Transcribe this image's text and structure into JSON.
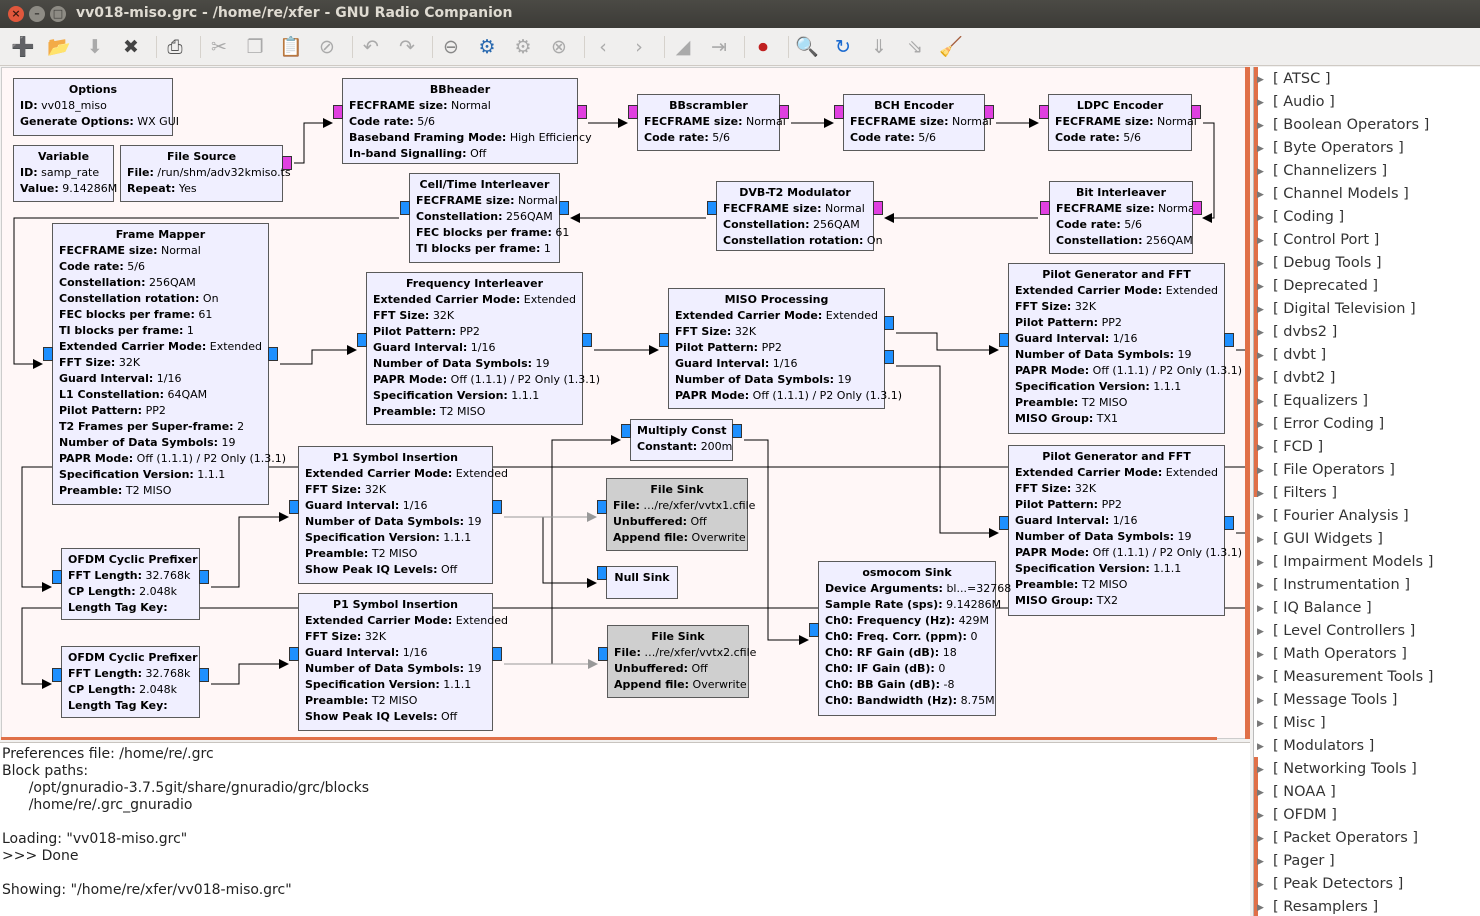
{
  "window": {
    "title": "vv018-miso.grc - /home/re/xfer - GNU Radio Companion",
    "close": "×",
    "minimize": "–",
    "maximize": "□"
  },
  "toolbar": [
    {
      "name": "new-icon",
      "glyph": "➕",
      "color": "#3c9a3c"
    },
    {
      "name": "open-icon",
      "glyph": "📂",
      "color": "#c87020"
    },
    {
      "name": "save-icon",
      "glyph": "⬇",
      "color": "#aaa"
    },
    {
      "name": "close-flowgraph-icon",
      "glyph": "✖",
      "color": "#444"
    },
    {
      "sep": true
    },
    {
      "name": "print-icon",
      "glyph": "⎙",
      "color": "#555"
    },
    {
      "sep": true
    },
    {
      "name": "cut-icon",
      "glyph": "✂",
      "color": "#aaa"
    },
    {
      "name": "copy-icon",
      "glyph": "❐",
      "color": "#aaa"
    },
    {
      "name": "paste-icon",
      "glyph": "📋",
      "color": "#aaa"
    },
    {
      "name": "delete-icon",
      "glyph": "⊘",
      "color": "#aaa"
    },
    {
      "sep": true
    },
    {
      "name": "undo-icon",
      "glyph": "↶",
      "color": "#aaa"
    },
    {
      "name": "redo-icon",
      "glyph": "↷",
      "color": "#aaa"
    },
    {
      "sep": true
    },
    {
      "name": "disable-icon",
      "glyph": "⊖",
      "color": "#888"
    },
    {
      "name": "generate-icon",
      "glyph": "⚙",
      "color": "#2a6ab0"
    },
    {
      "name": "execute-icon",
      "glyph": "⚙",
      "color": "#aaa"
    },
    {
      "name": "kill-icon",
      "glyph": "⊗",
      "color": "#aaa"
    },
    {
      "sep": true
    },
    {
      "name": "rotate-ccw-icon",
      "glyph": "‹",
      "color": "#aaa"
    },
    {
      "name": "rotate-cw-icon",
      "glyph": "›",
      "color": "#aaa"
    },
    {
      "sep": true
    },
    {
      "name": "enable-icon",
      "glyph": "◢",
      "color": "#aaa"
    },
    {
      "name": "bypass-icon",
      "glyph": "⇥",
      "color": "#aaa"
    },
    {
      "sep": true
    },
    {
      "name": "screenshot-icon",
      "glyph": "⏺",
      "color": "#c02020"
    },
    {
      "sep": true
    },
    {
      "name": "find-block-icon",
      "glyph": "🔍",
      "color": "#1a4a8a"
    },
    {
      "name": "reload-icon",
      "glyph": "↻",
      "color": "#1a6ad0"
    },
    {
      "name": "move-down-icon",
      "glyph": "⇓",
      "color": "#aaa"
    },
    {
      "name": "move-up-icon",
      "glyph": "⇘",
      "color": "#aaa"
    },
    {
      "name": "clean-icon",
      "glyph": "🧹",
      "color": "#c8a020"
    }
  ],
  "blocks": [
    {
      "name": "Options",
      "gray": false,
      "rows": [
        [
          "ID:",
          "vv018_miso"
        ],
        [
          "Generate Options:",
          "WX GUI"
        ]
      ]
    },
    {
      "name": "Variable",
      "gray": false,
      "rows": [
        [
          "ID:",
          "samp_rate"
        ],
        [
          "Value:",
          "9.14286M"
        ]
      ]
    },
    {
      "name": "File Source",
      "gray": false,
      "rows": [
        [
          "File:",
          "/run/shm/adv32kmiso.ts"
        ],
        [
          "Repeat:",
          "Yes"
        ]
      ]
    },
    {
      "name": "BBheader",
      "gray": false,
      "rows": [
        [
          "FECFRAME size:",
          "Normal"
        ],
        [
          "Code rate:",
          "5/6"
        ],
        [
          "Baseband Framing Mode:",
          "High Efficiency"
        ],
        [
          "In-band Signalling:",
          "Off"
        ]
      ]
    },
    {
      "name": "BBscrambler",
      "gray": false,
      "rows": [
        [
          "FECFRAME size:",
          "Normal"
        ],
        [
          "Code rate:",
          "5/6"
        ]
      ]
    },
    {
      "name": "BCH Encoder",
      "gray": false,
      "rows": [
        [
          "FECFRAME size:",
          "Normal"
        ],
        [
          "Code rate:",
          "5/6"
        ]
      ]
    },
    {
      "name": "LDPC Encoder",
      "gray": false,
      "rows": [
        [
          "FECFRAME size:",
          "Normal"
        ],
        [
          "Code rate:",
          "5/6"
        ]
      ]
    },
    {
      "name": "Cell/Time Interleaver",
      "gray": false,
      "rows": [
        [
          "FECFRAME size:",
          "Normal"
        ],
        [
          "Constellation:",
          "256QAM"
        ],
        [
          "FEC blocks per frame:",
          "61"
        ],
        [
          "TI blocks per frame:",
          "1"
        ]
      ]
    },
    {
      "name": "DVB-T2 Modulator",
      "gray": false,
      "rows": [
        [
          "FECFRAME size:",
          "Normal"
        ],
        [
          "Constellation:",
          "256QAM"
        ],
        [
          "Constellation rotation:",
          "On"
        ]
      ]
    },
    {
      "name": "Bit Interleaver",
      "gray": false,
      "rows": [
        [
          "FECFRAME size:",
          "Normal"
        ],
        [
          "Code rate:",
          "5/6"
        ],
        [
          "Constellation:",
          "256QAM"
        ]
      ]
    },
    {
      "name": "Frame Mapper",
      "gray": false,
      "rows": [
        [
          "FECFRAME size:",
          "Normal"
        ],
        [
          "Code rate:",
          "5/6"
        ],
        [
          "Constellation:",
          "256QAM"
        ],
        [
          "Constellation rotation:",
          "On"
        ],
        [
          "FEC blocks per frame:",
          "61"
        ],
        [
          "TI blocks per frame:",
          "1"
        ],
        [
          "Extended Carrier Mode:",
          "Extended"
        ],
        [
          "FFT Size:",
          "32K"
        ],
        [
          "Guard Interval:",
          "1/16"
        ],
        [
          "L1 Constellation:",
          "64QAM"
        ],
        [
          "Pilot Pattern:",
          "PP2"
        ],
        [
          "T2 Frames per Super-frame:",
          "2"
        ],
        [
          "Number of Data Symbols:",
          "19"
        ],
        [
          "PAPR Mode:",
          "Off (1.1.1) / P2 Only (1.3.1)"
        ],
        [
          "Specification Version:",
          "1.1.1"
        ],
        [
          "Preamble:",
          "T2 MISO"
        ]
      ]
    },
    {
      "name": "Frequency Interleaver",
      "gray": false,
      "rows": [
        [
          "Extended Carrier Mode:",
          "Extended"
        ],
        [
          "FFT Size:",
          "32K"
        ],
        [
          "Pilot Pattern:",
          "PP2"
        ],
        [
          "Guard Interval:",
          "1/16"
        ],
        [
          "Number of Data Symbols:",
          "19"
        ],
        [
          "PAPR Mode:",
          "Off (1.1.1) / P2 Only (1.3.1)"
        ],
        [
          "Specification Version:",
          "1.1.1"
        ],
        [
          "Preamble:",
          "T2 MISO"
        ]
      ]
    },
    {
      "name": "MISO Processing",
      "gray": false,
      "rows": [
        [
          "Extended Carrier Mode:",
          "Extended"
        ],
        [
          "FFT Size:",
          "32K"
        ],
        [
          "Pilot Pattern:",
          "PP2"
        ],
        [
          "Guard Interval:",
          "1/16"
        ],
        [
          "Number of Data Symbols:",
          "19"
        ],
        [
          "PAPR Mode:",
          "Off (1.1.1) / P2 Only (1.3.1)"
        ]
      ]
    },
    {
      "name": "Pilot Generator and FFT",
      "gray": false,
      "rows": [
        [
          "Extended Carrier Mode:",
          "Extended"
        ],
        [
          "FFT Size:",
          "32K"
        ],
        [
          "Pilot Pattern:",
          "PP2"
        ],
        [
          "Guard Interval:",
          "1/16"
        ],
        [
          "Number of Data Symbols:",
          "19"
        ],
        [
          "PAPR Mode:",
          "Off (1.1.1) / P2 Only (1.3.1)"
        ],
        [
          "Specification Version:",
          "1.1.1"
        ],
        [
          "Preamble:",
          "T2 MISO"
        ],
        [
          "MISO Group:",
          "TX1"
        ]
      ]
    },
    {
      "name": "Pilot Generator and FFT",
      "gray": false,
      "rows": [
        [
          "Extended Carrier Mode:",
          "Extended"
        ],
        [
          "FFT Size:",
          "32K"
        ],
        [
          "Pilot Pattern:",
          "PP2"
        ],
        [
          "Guard Interval:",
          "1/16"
        ],
        [
          "Number of Data Symbols:",
          "19"
        ],
        [
          "PAPR Mode:",
          "Off (1.1.1) / P2 Only (1.3.1)"
        ],
        [
          "Specification Version:",
          "1.1.1"
        ],
        [
          "Preamble:",
          "T2 MISO"
        ],
        [
          "MISO Group:",
          "TX2"
        ]
      ]
    },
    {
      "name": "Multiply Const",
      "gray": false,
      "rows": [
        [
          "Constant:",
          "200m"
        ]
      ]
    },
    {
      "name": "P1 Symbol Insertion",
      "gray": false,
      "rows": [
        [
          "Extended Carrier Mode:",
          "Extended"
        ],
        [
          "FFT Size:",
          "32K"
        ],
        [
          "Guard Interval:",
          "1/16"
        ],
        [
          "Number of Data Symbols:",
          "19"
        ],
        [
          "Specification Version:",
          "1.1.1"
        ],
        [
          "Preamble:",
          "T2 MISO"
        ],
        [
          "Show Peak IQ Levels:",
          "Off"
        ]
      ]
    },
    {
      "name": "File Sink",
      "gray": true,
      "rows": [
        [
          "File:",
          "…/re/xfer/vvtx1.cfile"
        ],
        [
          "Unbuffered:",
          "Off"
        ],
        [
          "Append file:",
          "Overwrite"
        ]
      ]
    },
    {
      "name": "Null Sink",
      "gray": false,
      "rows": []
    },
    {
      "name": "OFDM Cyclic Prefixer",
      "gray": false,
      "rows": [
        [
          "FFT Length:",
          "32.768k"
        ],
        [
          "CP Length:",
          "2.048k"
        ],
        [
          "Length Tag Key:",
          ""
        ]
      ]
    },
    {
      "name": "P1 Symbol Insertion",
      "gray": false,
      "rows": [
        [
          "Extended Carrier Mode:",
          "Extended"
        ],
        [
          "FFT Size:",
          "32K"
        ],
        [
          "Guard Interval:",
          "1/16"
        ],
        [
          "Number of Data Symbols:",
          "19"
        ],
        [
          "Specification Version:",
          "1.1.1"
        ],
        [
          "Preamble:",
          "T2 MISO"
        ],
        [
          "Show Peak IQ Levels:",
          "Off"
        ]
      ]
    },
    {
      "name": "File Sink",
      "gray": true,
      "rows": [
        [
          "File:",
          "…/re/xfer/vvtx2.cfile"
        ],
        [
          "Unbuffered:",
          "Off"
        ],
        [
          "Append file:",
          "Overwrite"
        ]
      ]
    },
    {
      "name": "osmocom Sink",
      "gray": false,
      "rows": [
        [
          "Device Arguments:",
          "bl...=32768"
        ],
        [
          "Sample Rate (sps):",
          "9.14286M"
        ],
        [
          "Ch0: Frequency (Hz):",
          "429M"
        ],
        [
          "Ch0: Freq. Corr. (ppm):",
          "0"
        ],
        [
          "Ch0: RF Gain (dB):",
          "18"
        ],
        [
          "Ch0: IF Gain (dB):",
          "0"
        ],
        [
          "Ch0: BB Gain (dB):",
          "-8"
        ],
        [
          "Ch0: Bandwidth (Hz):",
          "8.75M"
        ]
      ]
    },
    {
      "name": "OFDM Cyclic Prefixer",
      "gray": false,
      "rows": [
        [
          "FFT Length:",
          "32.768k"
        ],
        [
          "CP Length:",
          "2.048k"
        ],
        [
          "Length Tag Key:",
          ""
        ]
      ]
    }
  ],
  "console": {
    "lines": [
      "Preferences file: /home/re/.grc",
      "Block paths:",
      "      /opt/gnuradio-3.7.5git/share/gnuradio/grc/blocks",
      "      /home/re/.grc_gnuradio",
      "",
      "Loading: \"vv018-miso.grc\"",
      ">>> Done",
      "",
      "Showing: \"/home/re/xfer/vv018-miso.grc\""
    ]
  },
  "categories": [
    "[ ATSC ]",
    "[ Audio ]",
    "[ Boolean Operators ]",
    "[ Byte Operators ]",
    "[ Channelizers ]",
    "[ Channel Models ]",
    "[ Coding ]",
    "[ Control Port ]",
    "[ Debug Tools ]",
    "[ Deprecated ]",
    "[ Digital Television ]",
    "[ dvbs2 ]",
    "[ dvbt ]",
    "[ dvbt2 ]",
    "[ Equalizers ]",
    "[ Error Coding ]",
    "[ FCD ]",
    "[ File Operators ]",
    "[ Filters ]",
    "[ Fourier Analysis ]",
    "[ GUI Widgets ]",
    "[ Impairment Models ]",
    "[ Instrumentation ]",
    "[ IQ Balance ]",
    "[ Level Controllers ]",
    "[ Math Operators ]",
    "[ Measurement Tools ]",
    "[ Message Tools ]",
    "[ Misc ]",
    "[ Modulators ]",
    "[ Networking Tools ]",
    "[ NOAA ]",
    "[ OFDM ]",
    "[ Packet Operators ]",
    "[ Pager ]",
    "[ Peak Detectors ]",
    "[ Resamplers ]"
  ],
  "colors": {
    "byte_port": "#e040e0",
    "complex_port": "#1e90ff",
    "float_port": "#ff8c00",
    "wire": "#000000",
    "disabled_wire": "#999999",
    "accent": "#e07048"
  }
}
